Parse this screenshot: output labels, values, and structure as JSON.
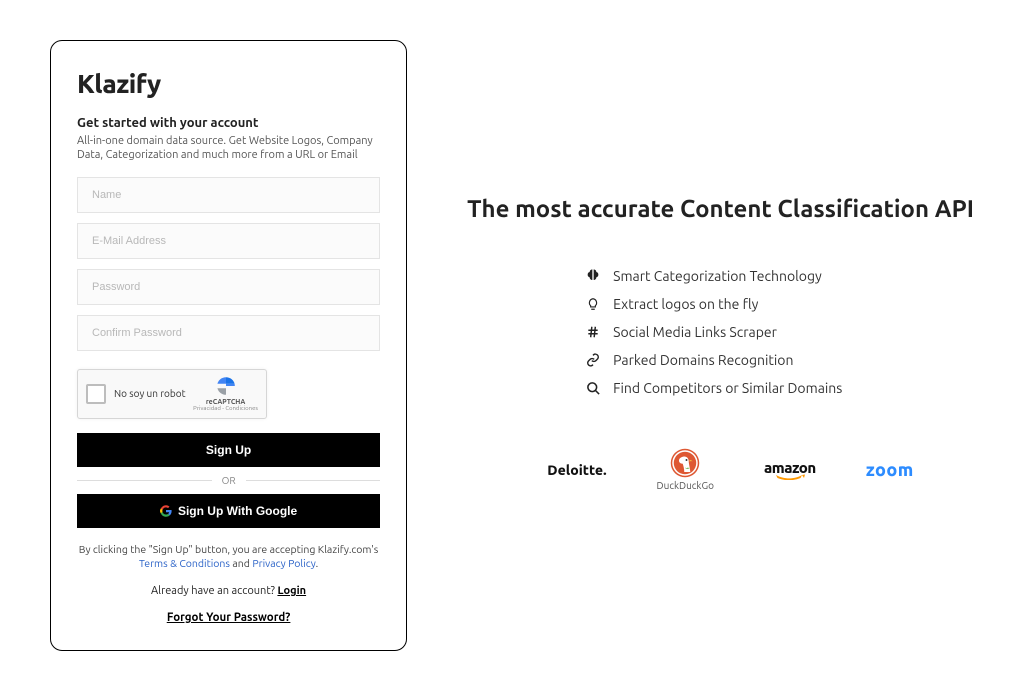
{
  "brand": "Klazify",
  "subtitle": "Get started with your account",
  "subdesc": "All-in-one domain data source. Get Website Logos, Company Data, Categorization and much more from a URL or Email",
  "fields": {
    "name_placeholder": "Name",
    "email_placeholder": "E-Mail Address",
    "password_placeholder": "Password",
    "confirm_placeholder": "Confirm Password"
  },
  "recaptcha": {
    "label": "No soy un robot",
    "brand": "reCAPTCHA",
    "legal": "Privacidad - Condiciones"
  },
  "buttons": {
    "signup": "Sign Up",
    "or": "OR",
    "google": "Sign Up With Google"
  },
  "terms": {
    "prefix": "By clicking the \"Sign Up\" button, you are accepting Klazify.com's ",
    "terms_link": "Terms & Conditions",
    "and": " and ",
    "privacy_link": "Privacy Policy",
    "suffix": "."
  },
  "already": {
    "text": "Already have an account? ",
    "login": "Login"
  },
  "forgot": "Forgot Your Password?",
  "headline": "The most accurate Content Classification API",
  "features": [
    "Smart Categorization Technology",
    "Extract logos on the fly",
    "Social Media Links Scraper",
    "Parked Domains Recognition",
    "Find Competitors or Similar Domains"
  ],
  "logos": {
    "deloitte": "Deloitte",
    "duckduckgo": "DuckDuckGo",
    "amazon": "amazon",
    "zoom": "zoom"
  }
}
